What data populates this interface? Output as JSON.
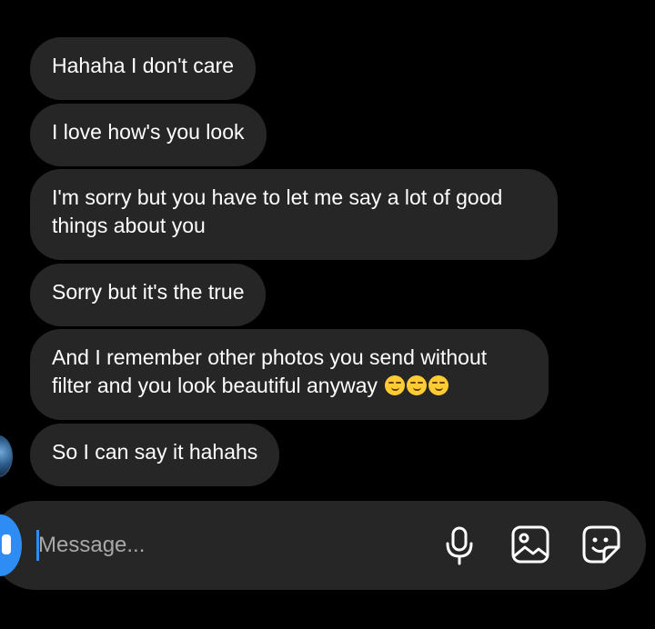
{
  "messages": [
    {
      "text": "Hahaha I don't care",
      "emoji_count": 0
    },
    {
      "text": "I love how's you look",
      "emoji_count": 0
    },
    {
      "text": "I'm sorry but you have to let me say a lot of good things about you",
      "emoji_count": 0
    },
    {
      "text": "Sorry but it's the true",
      "emoji_count": 0
    },
    {
      "text": "And I remember other photos you send without filter and you look beautiful anyway",
      "emoji": "😏😏😏",
      "emoji_count": 3
    },
    {
      "text": "So I can say it hahahs",
      "emoji_count": 0
    }
  ],
  "composer": {
    "placeholder": "Message..."
  },
  "icons": {
    "camera": "camera-icon",
    "microphone": "microphone-icon",
    "gallery": "gallery-icon",
    "sticker": "sticker-icon",
    "avatar": "avatar"
  },
  "colors": {
    "background": "#000000",
    "bubble": "#262626",
    "composer": "#262626",
    "accent": "#2e8df5",
    "placeholder": "#a8a8a8",
    "text": "#ffffff"
  }
}
